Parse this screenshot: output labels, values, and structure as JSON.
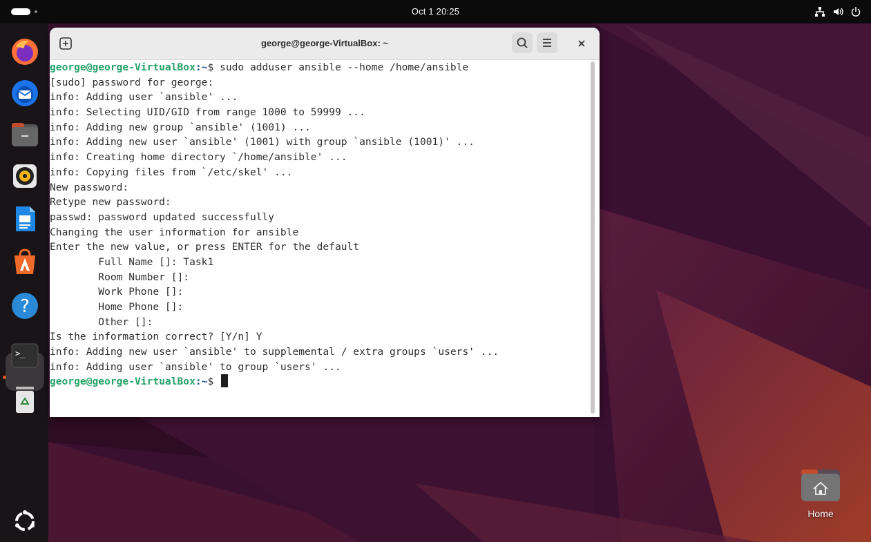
{
  "topbar": {
    "clock": "Oct 1  20:25",
    "tray_icons": [
      "network-icon",
      "volume-icon",
      "power-icon"
    ]
  },
  "dock": {
    "apps": [
      "Firefox",
      "Thunderbird",
      "Files",
      "Rhythmbox",
      "LibreOffice Writer",
      "App Center",
      "Help",
      "Terminal",
      "Trash",
      "Show Apps"
    ],
    "running": "Terminal"
  },
  "terminal": {
    "title": "george@george-VirtualBox: ~",
    "prompt_user": "george@george-VirtualBox",
    "prompt_path": ":~",
    "prompt_symbol": "$ ",
    "command": "sudo adduser ansible --home /home/ansible",
    "output_lines": [
      "[sudo] password for george:",
      "info: Adding user `ansible' ...",
      "info: Selecting UID/GID from range 1000 to 59999 ...",
      "info: Adding new group `ansible' (1001) ...",
      "info: Adding new user `ansible' (1001) with group `ansible (1001)' ...",
      "info: Creating home directory `/home/ansible' ...",
      "info: Copying files from `/etc/skel' ...",
      "New password:",
      "Retype new password:",
      "passwd: password updated successfully",
      "Changing the user information for ansible",
      "Enter the new value, or press ENTER for the default",
      "        Full Name []: Task1",
      "        Room Number []:",
      "        Work Phone []:",
      "        Home Phone []:",
      "        Other []:",
      "Is the information correct? [Y/n] Y",
      "info: Adding new user `ansible' to supplemental / extra groups `users' ...",
      "info: Adding user `ansible' to group `users' ..."
    ]
  },
  "desktop": {
    "home_label": "Home"
  },
  "colors": {
    "prompt_user": "#26a269",
    "prompt_path": "#12488b",
    "accent": "#e95420"
  }
}
